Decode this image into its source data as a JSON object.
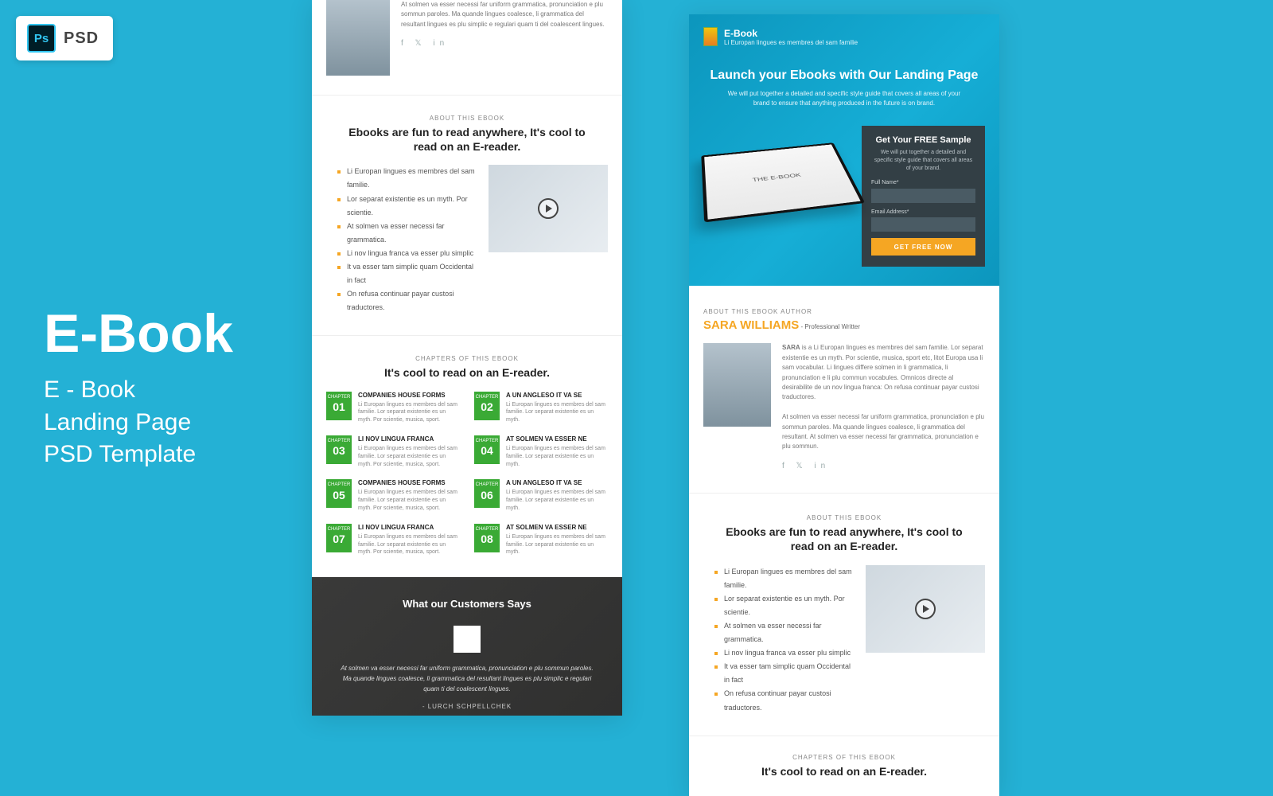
{
  "badge": {
    "icon": "Ps",
    "text": "PSD"
  },
  "headline": {
    "title": "E-Book",
    "subtitle": "E - Book\nLanding Page\nPSD Template"
  },
  "author_block": {
    "para1": "At solmen va esser necessi far uniform grammatica, pronunciation e plu sommun paroles. Ma quande lingues coalesce, li grammatica del resultant lingues es plu simplic e regulari quam ti del coalescent lingues.",
    "social": "f   𝕏   in"
  },
  "about": {
    "kicker": "ABOUT THIS EBOOK",
    "title": "Ebooks are fun to read anywhere, It's  cool to read on an E-reader.",
    "bullets": [
      "Li Europan lingues es membres del sam familie.",
      "Lor separat existentie es un myth. Por scientie.",
      "At solmen va esser necessi far grammatica.",
      "Li nov lingua franca va esser plu simplic",
      "It va esser tam simplic quam Occidental in fact",
      "On refusa continuar payar custosi traductores."
    ]
  },
  "chapters": {
    "kicker": "CHAPTERS OF THIS EBOOK",
    "title": "It's  cool to read on an E-reader.",
    "badge_label": "CHAPTER",
    "items": [
      {
        "num": "01",
        "title": "COMPANIES HOUSE FORMS",
        "desc": "Li Europan lingues es membres del sam familie. Lor separat existentie es un myth. Por scientie, musica, sport."
      },
      {
        "num": "02",
        "title": "A UN ANGLESO IT VA SE",
        "desc": "Li Europan lingues es membres del sam familie. Lor separat existentie es un myth."
      },
      {
        "num": "03",
        "title": "LI NOV LINGUA FRANCA",
        "desc": "Li Europan lingues es membres del sam familie. Lor separat existentie es un myth. Por scientie, musica, sport."
      },
      {
        "num": "04",
        "title": "AT SOLMEN VA ESSER NE",
        "desc": "Li Europan lingues es membres del sam familie. Lor separat existentie es un myth."
      },
      {
        "num": "05",
        "title": "COMPANIES HOUSE FORMS",
        "desc": "Li Europan lingues es membres del sam familie. Lor separat existentie es un myth. Por scientie, musica, sport."
      },
      {
        "num": "06",
        "title": "A UN ANGLESO IT VA SE",
        "desc": "Li Europan lingues es membres del sam familie. Lor separat existentie es un myth."
      },
      {
        "num": "07",
        "title": "LI NOV LINGUA FRANCA",
        "desc": "Li Europan lingues es membres del sam familie. Lor separat existentie es un myth. Por scientie, musica, sport."
      },
      {
        "num": "08",
        "title": "AT SOLMEN VA ESSER NE",
        "desc": "Li Europan lingues es membres del sam familie. Lor separat existentie es un myth."
      }
    ]
  },
  "testimonials": {
    "title": "What our Customers Says",
    "quote": "At solmen va esser necessi far uniform grammatica, pronunciation e plu sommun paroles. Ma quande lingues coalesce, li grammatica del resultant lingues es plu simplic e regulari quam ti del coalescent lingues.",
    "signature": "- LURCH SCHPELLCHEK"
  },
  "hero": {
    "brand_title": "E-Book",
    "brand_tag": "Li Europan lingues es membres del sam familie",
    "headline": "Launch your Ebooks with Our Landing Page",
    "lead": "We will put together a detailed and specific style guide that covers all areas of your brand to ensure that anything produced in the future is on brand.",
    "device_text": "THE E-BOOK"
  },
  "form": {
    "title": "Get Your FREE Sample",
    "desc": "We will put together a detailed and specific style guide that covers all areas of your brand.",
    "name_label": "Full Name*",
    "email_label": "Email Address*",
    "button": "GET FREE NOW"
  },
  "author2": {
    "kicker": "ABOUT THIS EBOOK AUTHOR",
    "name": "SARA WILLIAMS",
    "role": " - Professional Writter",
    "p1b": "SARA",
    "p1": " is a Li Europan lingues es membres del sam familie. Lor separat existentie es un myth. Por scientie, musica, sport etc, litot Europa usa li sam vocabular. Li lingues differe solmen in li grammatica, li pronunciation e li plu commun vocabules. Omnicos directe al desirabilite de un nov lingua franca: On refusa continuar payar custosi traductores.",
    "p2": "At solmen va esser necessi far uniform grammatica, pronunciation e plu sommun paroles. Ma quande lingues coalesce, li grammatica del resultant. At solmen va esser necessi far grammatica, pronunciation e plu sommun.",
    "social": "f   𝕏   in"
  }
}
